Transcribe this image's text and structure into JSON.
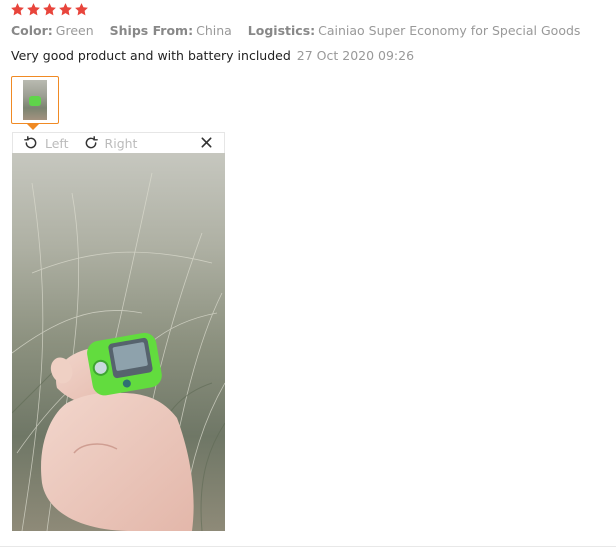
{
  "review": {
    "rating": 5,
    "star_color": "#e8453c",
    "attributes": [
      {
        "label": "Color:",
        "value": "Green"
      },
      {
        "label": "Ships From:",
        "value": "China"
      },
      {
        "label": "Logistics:",
        "value": "Cainiao Super Economy for Special Goods"
      }
    ],
    "text": "Very good product and with battery included",
    "date": "27 Oct 2020 09:26"
  },
  "viewer": {
    "rotate_left_label": "Left",
    "rotate_right_label": "Right",
    "accent_color": "#f08a24"
  }
}
